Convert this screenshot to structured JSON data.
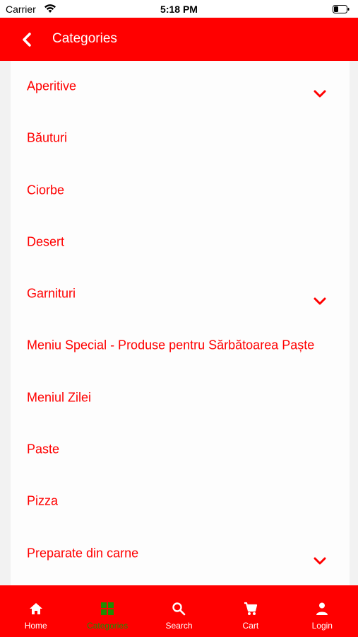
{
  "status_bar": {
    "carrier": "Carrier",
    "time": "5:18 PM"
  },
  "header": {
    "title": "Categories"
  },
  "colors": {
    "brand": "#ff0000",
    "active_tab": "#1e8c00"
  },
  "categories": [
    {
      "label": "Aperitive",
      "expandable": true
    },
    {
      "label": "Băuturi",
      "expandable": false
    },
    {
      "label": "Ciorbe",
      "expandable": false
    },
    {
      "label": "Desert",
      "expandable": false
    },
    {
      "label": "Garnituri",
      "expandable": true
    },
    {
      "label": "Meniu Special  - Produse pentru  Sărbătoarea Paște",
      "expandable": false
    },
    {
      "label": "Meniul Zilei",
      "expandable": false
    },
    {
      "label": "Paste",
      "expandable": false
    },
    {
      "label": "Pizza",
      "expandable": false
    },
    {
      "label": "Preparate din carne",
      "expandable": true
    }
  ],
  "tabs": [
    {
      "label": "Home",
      "icon": "home-icon",
      "active": false
    },
    {
      "label": "Categories",
      "icon": "grid-icon",
      "active": true
    },
    {
      "label": "Search",
      "icon": "search-icon",
      "active": false
    },
    {
      "label": "Cart",
      "icon": "cart-icon",
      "active": false
    },
    {
      "label": "Login",
      "icon": "person-icon",
      "active": false
    }
  ]
}
